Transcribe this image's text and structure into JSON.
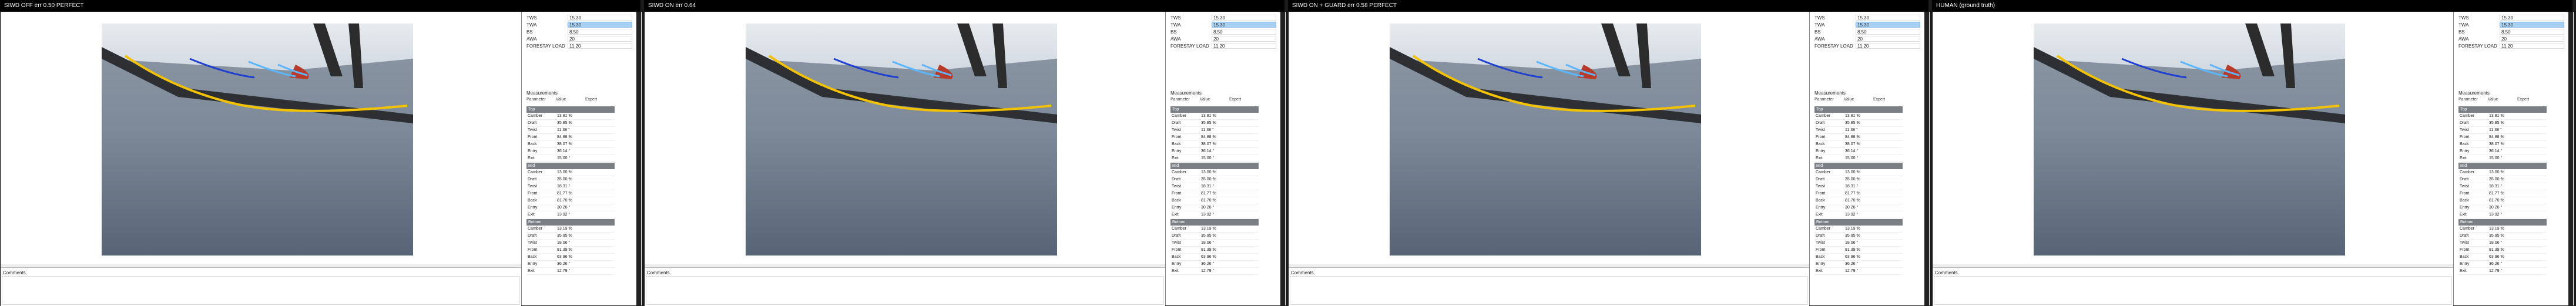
{
  "panels": [
    {
      "title": "SIWD OFF err 0.50 PERFECT",
      "curve": "#1f3fd1"
    },
    {
      "title": "SIWD ON err 0.64",
      "curve": "#1f3fd1"
    },
    {
      "title": "SIWD ON + GUARD err 0.58 PERFECT",
      "curve": "#1f3fd1"
    },
    {
      "title": "HUMAN (ground truth)",
      "curve": "#1f3fd1"
    }
  ],
  "form": [
    {
      "label": "TWS",
      "value": "15.30"
    },
    {
      "label": "TWA",
      "value": "15.30"
    },
    {
      "label": "BS",
      "value": "8.50"
    },
    {
      "label": "AWA",
      "value": "20"
    },
    {
      "label": "FORESTAY LOAD",
      "value": "11.20"
    }
  ],
  "measurements": {
    "title": "Measurements",
    "headers": [
      "Parameter",
      "Value",
      "Expert"
    ],
    "sections": [
      {
        "name": "Top",
        "rows": [
          [
            "Camber",
            "13.81 %",
            ""
          ],
          [
            "Draft",
            "35.85 %",
            ""
          ],
          [
            "Twist",
            "11.38 °",
            ""
          ],
          [
            "Front",
            "84.88 %",
            ""
          ],
          [
            "Back",
            "38.07 %",
            ""
          ],
          [
            "Entry",
            "36.14 °",
            ""
          ],
          [
            "Exit",
            "15.00 °",
            ""
          ]
        ]
      },
      {
        "name": "Mid",
        "rows": [
          [
            "Camber",
            "13.00 %",
            ""
          ],
          [
            "Draft",
            "35.00 %",
            ""
          ],
          [
            "Twist",
            "18.31 °",
            ""
          ],
          [
            "Front",
            "81.77 %",
            ""
          ],
          [
            "Back",
            "81.70 %",
            ""
          ],
          [
            "Entry",
            "30.26 °",
            ""
          ],
          [
            "Exit",
            "13.92 °",
            ""
          ]
        ]
      },
      {
        "name": "Bottom",
        "rows": [
          [
            "Camber",
            "13.19 %",
            ""
          ],
          [
            "Draft",
            "35.95 %",
            ""
          ],
          [
            "Twist",
            "18.06 °",
            ""
          ],
          [
            "Front",
            "81.39 %",
            ""
          ],
          [
            "Back",
            "63.96 %",
            ""
          ],
          [
            "Entry",
            "36.26 °",
            ""
          ],
          [
            "Exit",
            "12.79 °",
            ""
          ]
        ]
      }
    ]
  },
  "comment_label": "Comments"
}
